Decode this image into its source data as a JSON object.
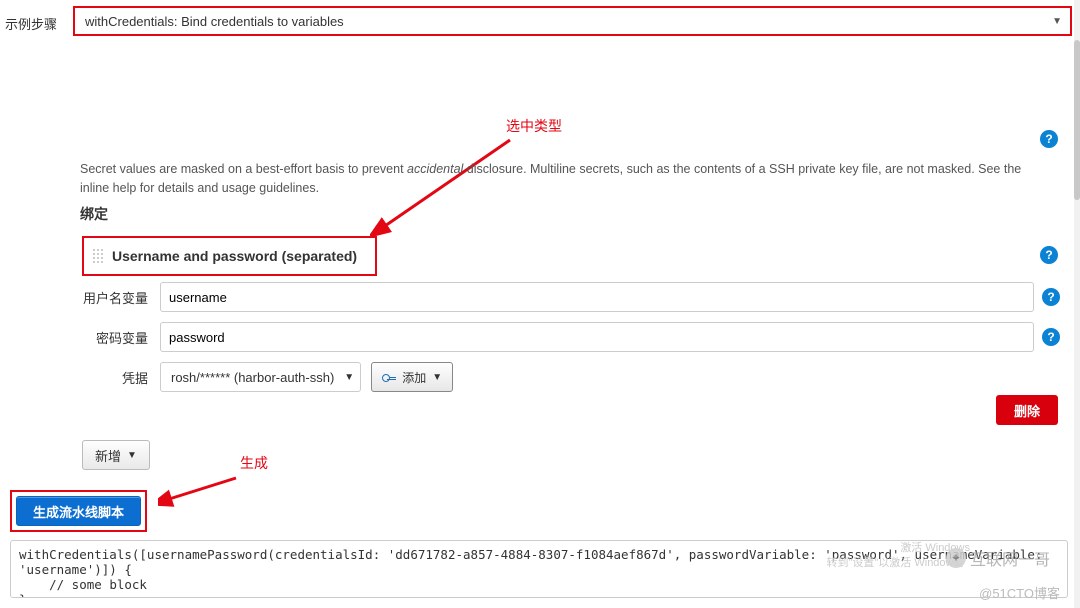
{
  "top": {
    "label": "示例步骤",
    "selected": "withCredentials: Bind credentials to variables"
  },
  "annotations": {
    "select_type": "选中类型",
    "generate": "生成"
  },
  "description": {
    "prefix": "Secret values are masked on a best-effort basis to prevent ",
    "italic": "accidental",
    "suffix": " disclosure. Multiline secrets, such as the contents of a SSH private key file, are not masked. See the inline help for details and usage guidelines."
  },
  "section": "绑定",
  "binding": {
    "title": "Username and password (separated)"
  },
  "form": {
    "username_label": "用户名变量",
    "username_value": "username",
    "password_label": "密码变量",
    "password_value": "password",
    "cred_label": "凭据",
    "cred_value": "rosh/****** (harbor-auth-ssh)",
    "add_label": "添加",
    "delete_label": "删除"
  },
  "buttons": {
    "new": "新增",
    "generate": "生成流水线脚本"
  },
  "code": "withCredentials([usernamePassword(credentialsId: 'dd671782-a857-4884-8307-f1084aef867d', passwordVariable: 'password', usernameVariable: 'username')]) {\n    // some block\n}",
  "watermark": {
    "source": "互联网一哥",
    "footer": "@51CTO博客",
    "faint1": "激活 Windows",
    "faint2": "转到\"设置\"以激活 Windows。"
  }
}
